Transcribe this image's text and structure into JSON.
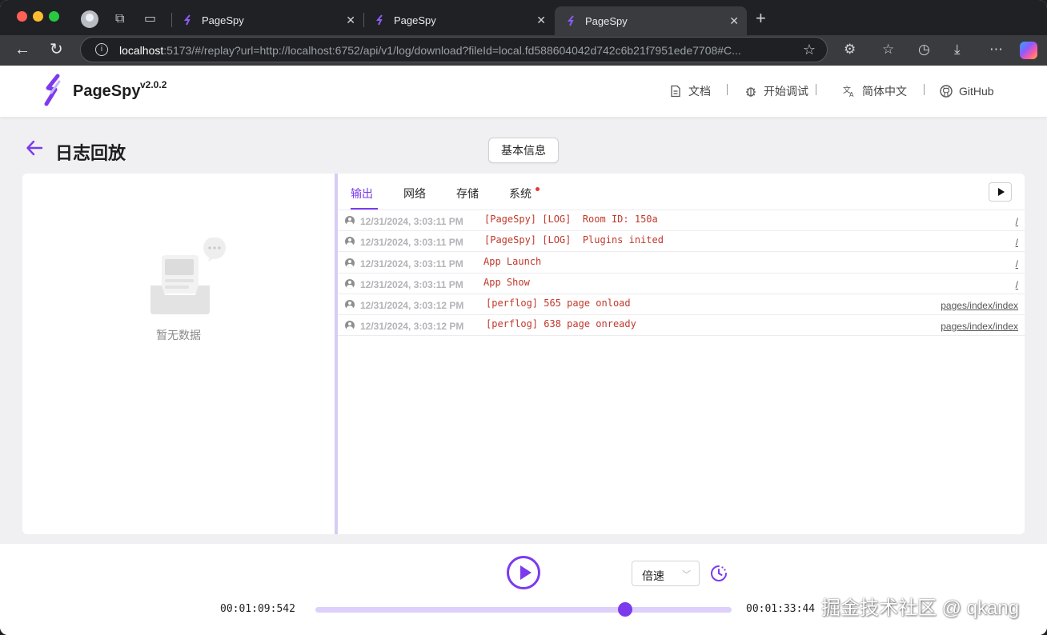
{
  "browser": {
    "tabs": [
      {
        "title": "PageSpy"
      },
      {
        "title": "PageSpy"
      },
      {
        "title": "PageSpy"
      }
    ],
    "url_host": "localhost",
    "url_rest": ":5173/#/replay?url=http://localhost:6752/api/v1/log/download?fileId=local.fd588604042d742c6b21f7951ede7708#C..."
  },
  "header": {
    "brand": "PageSpy",
    "version": "v2.0.2",
    "nav": {
      "docs": "文档",
      "debug": "开始调试",
      "lang": "简体中文",
      "github": "GitHub"
    }
  },
  "page": {
    "title": "日志回放",
    "info_button": "基本信息",
    "empty_text": "暂无数据"
  },
  "panel": {
    "tabs": {
      "output": "输出",
      "network": "网络",
      "storage": "存储",
      "system": "系统"
    },
    "logs": [
      {
        "time": "12/31/2024, 3:03:11 PM",
        "message": "[PageSpy] [LOG]  Room ID: 150a",
        "source": "/"
      },
      {
        "time": "12/31/2024, 3:03:11 PM",
        "message": "[PageSpy] [LOG]  Plugins inited",
        "source": "/"
      },
      {
        "time": "12/31/2024, 3:03:11 PM",
        "message": "App Launch",
        "source": "/"
      },
      {
        "time": "12/31/2024, 3:03:11 PM",
        "message": "App Show",
        "source": "/"
      },
      {
        "time": "12/31/2024, 3:03:12 PM",
        "message": "[perflog] 565 page onload",
        "source": "pages/index/index"
      },
      {
        "time": "12/31/2024, 3:03:12 PM",
        "message": "[perflog] 638 page onready",
        "source": "pages/index/index"
      }
    ]
  },
  "player": {
    "speed_label": "倍速",
    "current_time": "00:01:09:542",
    "total_time": "00:01:33:44",
    "progress": 0.745
  },
  "watermark": "掘金技术社区 @ qkang",
  "colors": {
    "accent": "#7c3aed",
    "log_text": "#c0392b",
    "track": "#ddd0fb"
  }
}
